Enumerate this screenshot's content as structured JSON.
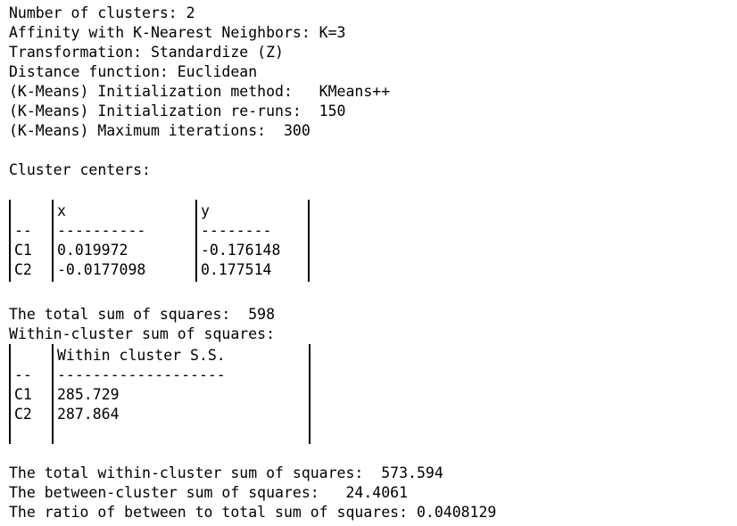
{
  "report": {
    "params": [
      {
        "label": "Number of clusters:",
        "value": "2",
        "text": "Number of clusters: 2"
      },
      {
        "label": "Affinity with K-Nearest Neighbors:",
        "value": "K=3",
        "text": "Affinity with K-Nearest Neighbors: K=3"
      },
      {
        "label": "Transformation:",
        "value": "Standardize (Z)",
        "text": "Transformation: Standardize (Z)"
      },
      {
        "label": "Distance function:",
        "value": "Euclidean",
        "text": "Distance function: Euclidean"
      },
      {
        "label": "(K-Means) Initialization method:",
        "value": "KMeans++",
        "text": "(K-Means) Initialization method:   KMeans++"
      },
      {
        "label": "(K-Means) Initialization re-runs:",
        "value": "150",
        "text": "(K-Means) Initialization re-runs:  150"
      },
      {
        "label": "(K-Means) Maximum iterations:",
        "value": "300",
        "text": "(K-Means) Maximum iterations:  300"
      }
    ],
    "centers": {
      "heading": "Cluster centers:",
      "corner": "",
      "rule_label": "--",
      "columns": [
        "x",
        "y"
      ],
      "col_rules": [
        "----------",
        "--------"
      ],
      "rows": [
        {
          "name": "C1",
          "x": "0.019972",
          "y": "-0.176148"
        },
        {
          "name": "C2",
          "x": "-0.0177098",
          "y": "0.177514"
        }
      ]
    },
    "total_ss": {
      "text": "The total sum of squares:  598",
      "label": "The total sum of squares:",
      "value": "598"
    },
    "within": {
      "heading": "Within-cluster sum of squares:",
      "rule_label": "--",
      "column": "Within cluster S.S.",
      "col_rule": "-------------------",
      "rows": [
        {
          "name": "C1",
          "value": "285.729"
        },
        {
          "name": "C2",
          "value": "287.864"
        }
      ]
    },
    "summary": [
      {
        "label": "The total within-cluster sum of squares:",
        "value": "573.594",
        "text": "The total within-cluster sum of squares:  573.594"
      },
      {
        "label": "The between-cluster sum of squares:",
        "value": "24.4061",
        "text": "The between-cluster sum of squares:   24.4061"
      },
      {
        "label": "The ratio of between to total sum of squares:",
        "value": "0.0408129",
        "text": "The ratio of between to total sum of squares: 0.0408129"
      }
    ]
  }
}
